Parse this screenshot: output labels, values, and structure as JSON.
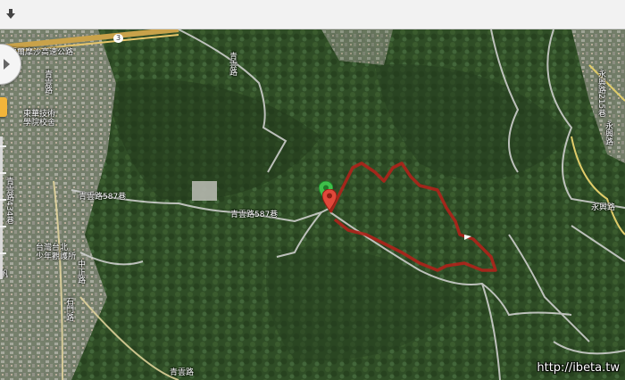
{
  "toolbar": {
    "icon": "download-icon"
  },
  "map": {
    "type": "satellite",
    "road_labels": {
      "freeway": "福爾摩沙高速公路",
      "route_num": "3",
      "qinyun_587": "青雲路587巷",
      "qinyun_587_b": "青雲路587巷",
      "qinyun_434": "青雲路434巷",
      "qinyun_road": "青雲路",
      "qinyun_road_bottom": "青雲路",
      "shishi_road": "石門路",
      "qinyu_road": "青雲路",
      "yongxing_215": "永興路215巷",
      "yongxing": "永興路",
      "yongxing_2": "永興路",
      "zhongzheng": "中正路",
      "fanyuan": "帆",
      "prison": "台灣台北\n少年觀護所",
      "school": "東華技術\n學院校舍"
    },
    "markers": [
      {
        "name": "start-marker",
        "color": "#3fbf4a"
      },
      {
        "name": "end-marker",
        "color": "#e0483a"
      }
    ],
    "track_color": "#b0221b"
  },
  "watermark": "http://ibeta.tw"
}
